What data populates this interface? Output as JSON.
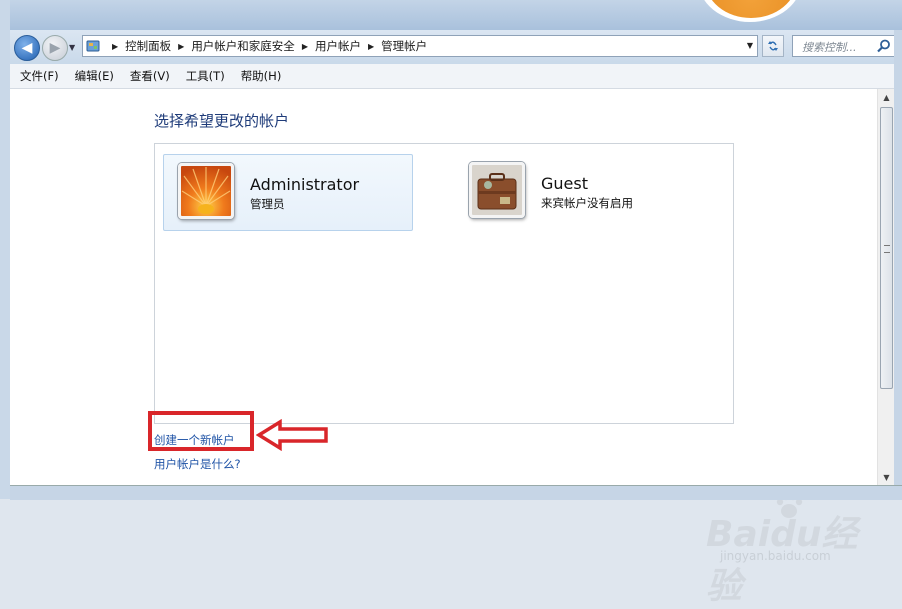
{
  "breadcrumbs": [
    "控制面板",
    "用户帐户和家庭安全",
    "用户帐户",
    "管理帐户"
  ],
  "search": {
    "placeholder": "搜索控制..."
  },
  "menu": [
    "文件(F)",
    "编辑(E)",
    "查看(V)",
    "工具(T)",
    "帮助(H)"
  ],
  "main": {
    "heading": "选择希望更改的帐户",
    "accounts": [
      {
        "name": "Administrator",
        "role": "管理员",
        "picture": "orange-flower-picture"
      },
      {
        "name": "Guest",
        "role": "来宾帐户没有启用",
        "picture": "briefcase-picture"
      }
    ],
    "create_link": "创建一个新帐户",
    "whatis_link": "用户帐户是什么?"
  },
  "watermark": {
    "main": "Baidu经验",
    "sub": "jingyan.baidu.com"
  },
  "colors": {
    "link": "#1f53a6",
    "heading": "#1f3c7a",
    "annotation": "#d9262a"
  }
}
